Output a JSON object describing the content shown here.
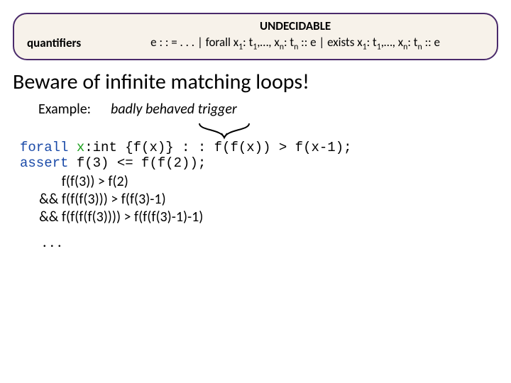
{
  "rule": {
    "label": "quantifiers",
    "undecidable": "UNDECIDABLE",
    "grammar_prefix": "e : : = . . . | forall x",
    "grammar_mid1": ": t",
    "grammar_mid2": ",…, x",
    "grammar_mid3": ": t",
    "grammar_mid4": " :: e | exists x",
    "grammar_mid5": ": t",
    "grammar_mid6": ",…, x",
    "grammar_mid7": ": t",
    "grammar_suffix": " :: e",
    "s1": "1",
    "sn": "n"
  },
  "heading": "Beware of infinite matching loops!",
  "example_label": "Example:",
  "trigger_note": "badly behaved trigger",
  "code": {
    "kw_forall": "forall",
    "var_x": "x",
    "l1_rest": ":int {f(x)} : : f(f(x)) > f(x-1);",
    "kw_assert": "assert",
    "l2_rest": " f(3) <= f(f(2));"
  },
  "post": {
    "p1": "             f(f(3)) > f(2)",
    "p2": "      && f(f(f(3))) > f(f(3)-1)",
    "p3": "      && f(f(f(f(3)))) > f(f(f(3)-1)-1)"
  },
  "dots": ". . ."
}
